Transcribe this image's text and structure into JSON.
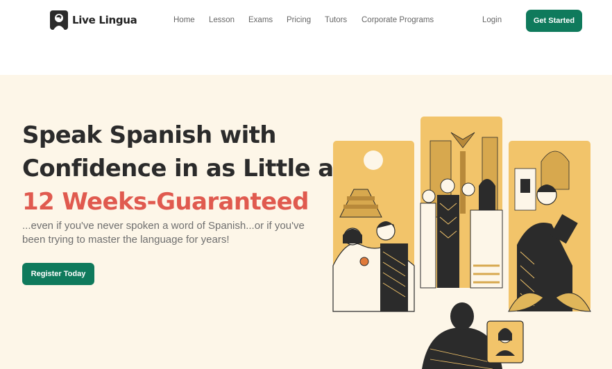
{
  "brand": {
    "name": "Live Lingua",
    "logo_icon": "lingua-logo-icon"
  },
  "nav": {
    "items": [
      {
        "label": "Home"
      },
      {
        "label": "Lesson"
      },
      {
        "label": "Exams"
      },
      {
        "label": "Pricing"
      },
      {
        "label": "Tutors"
      },
      {
        "label": "Corporate Programs"
      }
    ],
    "login_label": "Login",
    "cta_label": "Get Started"
  },
  "hero": {
    "heading_line1": "Speak Spanish with",
    "heading_line2": "Confidence in as Little as",
    "heading_accent": "12 Weeks-Guaranteed",
    "subtitle": "...even if you've never spoken a word of Spanish...or if you've been trying to master the language for years!",
    "cta_label": "Register Today"
  },
  "colors": {
    "accent_green": "#0f7a5c",
    "accent_red": "#e05a4f",
    "hero_bg": "#fdf6e8",
    "illustration_yellow": "#f2c46a"
  }
}
